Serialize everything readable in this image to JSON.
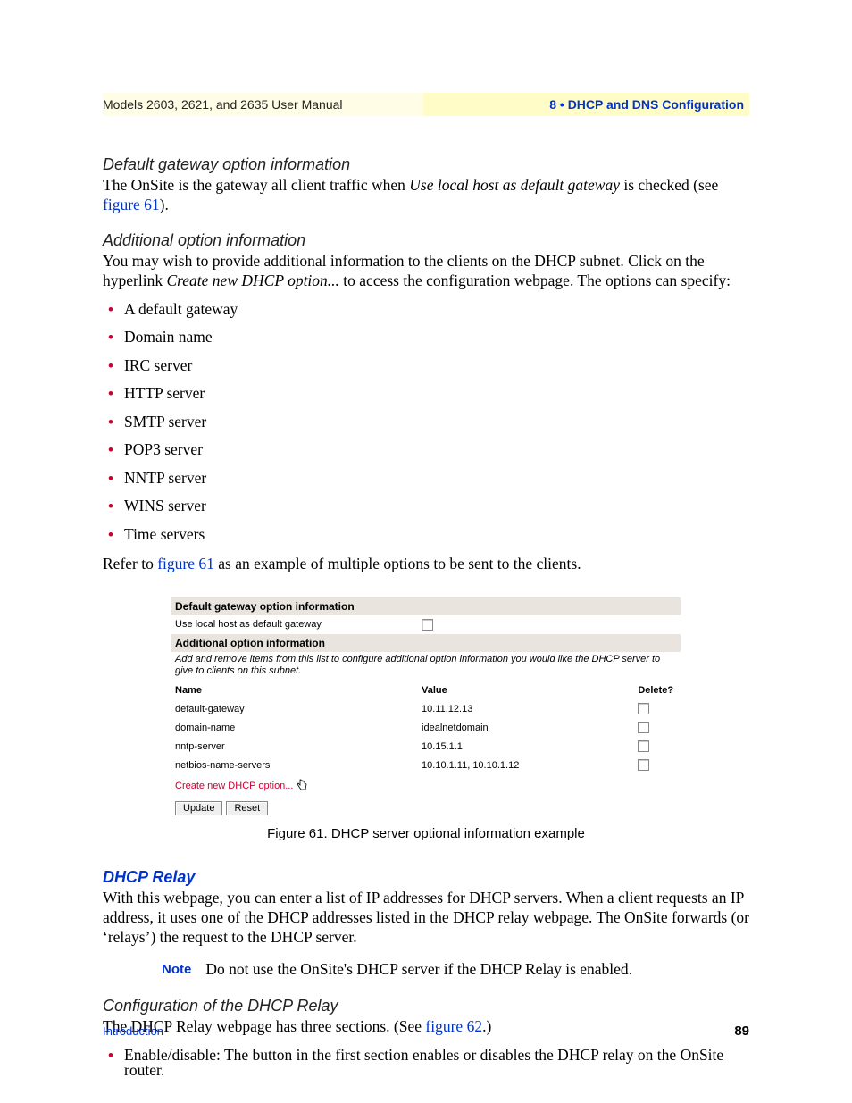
{
  "header": {
    "left": "Models 2603, 2621, and 2635 User Manual",
    "right": "8 • DHCP and DNS Configuration"
  },
  "sec1": {
    "title": "Default gateway option information",
    "p_a": "The OnSite is the gateway all client traffic when ",
    "p_em": "Use local host as default gateway",
    "p_b": " is checked (see ",
    "p_link": "figure 61",
    "p_c": ")."
  },
  "sec2": {
    "title": "Additional option information",
    "p_a": "You may wish to provide additional information to the clients on the DHCP subnet. Click on the hyperlink ",
    "p_em": "Create new DHCP option...",
    "p_b": " to access the configuration webpage. The options can specify:",
    "items": [
      "A default gateway",
      "Domain name",
      "IRC server",
      "HTTP server",
      "SMTP server",
      "POP3 server",
      "NNTP server",
      "WINS server",
      "Time servers"
    ],
    "refer_a": "Refer to ",
    "refer_link": "figure 61",
    "refer_b": " as an example of multiple options to be sent to the clients."
  },
  "figure": {
    "hdr1": "Default gateway option information",
    "row_localhost": "Use local host as default gateway",
    "hdr2": "Additional option information",
    "desc": "Add and remove items from this list to configure additional option information you would like the DHCP server to give to clients on this subnet.",
    "col_name": "Name",
    "col_value": "Value",
    "col_del": "Delete?",
    "rows": [
      {
        "name": "default-gateway",
        "value": "10.11.12.13"
      },
      {
        "name": "domain-name",
        "value": "idealnetdomain"
      },
      {
        "name": "nntp-server",
        "value": "10.15.1.1"
      },
      {
        "name": "netbios-name-servers",
        "value": "10.10.1.11, 10.10.1.12"
      }
    ],
    "create_link": "Create new DHCP option...",
    "btn_update": "Update",
    "btn_reset": "Reset",
    "caption": "Figure 61. DHCP server optional information example"
  },
  "relay": {
    "title": "DHCP Relay",
    "p": "With this webpage, you can enter a list of IP addresses for DHCP servers. When a client requests an IP address, it uses one of the DHCP addresses listed in the DHCP relay webpage. The OnSite forwards (or ‘relays’) the request to the DHCP server.",
    "note_label": "Note",
    "note_text": "Do not use the OnSite's DHCP server if the DHCP Relay is enabled."
  },
  "config": {
    "title": "Configuration of the DHCP Relay",
    "p_a": "The DHCP Relay webpage has three sections. (See ",
    "p_link": "figure 62",
    "p_b": ".)",
    "bullet": "Enable/disable: The button in the first section enables or disables the DHCP relay on the OnSite router."
  },
  "footer": {
    "left": "Introduction",
    "page": "89"
  }
}
